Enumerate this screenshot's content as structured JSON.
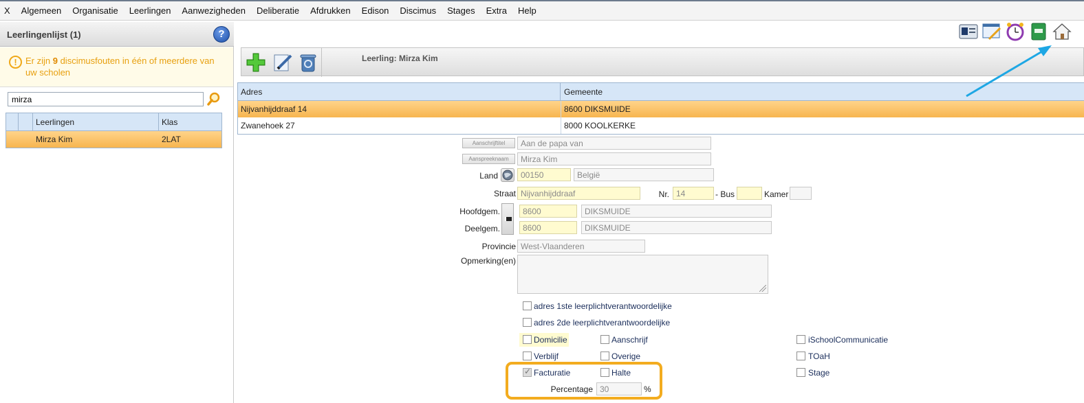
{
  "menu": [
    "X",
    "Algemeen",
    "Organisatie",
    "Leerlingen",
    "Aanwezigheden",
    "Deliberatie",
    "Afdrukken",
    "Edison",
    "Discimus",
    "Stages",
    "Extra",
    "Help"
  ],
  "left_panel": {
    "title": "Leerlingenlijst (1)",
    "help": "?",
    "warning_prefix": "Er zijn ",
    "warning_count": "9",
    "warning_suffix": " discimusfouten in één of meerdere van uw scholen",
    "search_value": "mirza",
    "columns": [
      "Leerlingen",
      "Klas"
    ],
    "rows": [
      {
        "name": "Mirza Kim",
        "klas": "2LAT"
      }
    ]
  },
  "toolbar": {
    "title": "Leerling: Mirza Kim"
  },
  "addresses": {
    "columns": [
      "Adres",
      "Gemeente"
    ],
    "rows": [
      {
        "adres": "Nijvanhijddraaf 14",
        "gemeente": "8600 DIKSMUIDE",
        "selected": true
      },
      {
        "adres": "Zwanehoek 27",
        "gemeente": "8000 KOOLKERKE",
        "selected": false
      }
    ]
  },
  "form": {
    "aanschrijftitel_btn": "Aanschrijftitel",
    "aanschrijftitel": "Aan de papa van",
    "aanspreeknaam_btn": "Aanspreeknaam",
    "aanspreeknaam": "Mirza Kim",
    "land_label": "Land",
    "land_code": "00150",
    "land_name": "België",
    "straat_label": "Straat",
    "straat": "Nijvanhijddraaf",
    "nr_label": "Nr.",
    "nr": "14",
    "bus_label": "- Bus",
    "bus": "",
    "kamer_label": "Kamer",
    "kamer": "",
    "hoofdgem_label": "Hoofdgem.",
    "hoofdgem_code": "8600",
    "hoofdgem_name": "DIKSMUIDE",
    "deelgem_label": "Deelgem.",
    "deelgem_code": "8600",
    "deelgem_name": "DIKSMUIDE",
    "provincie_label": "Provincie",
    "provincie": "West-Vlaanderen",
    "opmerking_label": "Opmerking(en)",
    "opmerking": "",
    "cb_1ste": "adres 1ste leerplichtverantwoordelijke",
    "cb_2de": "adres 2de leerplichtverantwoordelijke",
    "cb_domicilie": "Domicilie",
    "cb_aanschrijf": "Aanschrijf",
    "cb_ischool": "iSchoolCommunicatie",
    "cb_verblijf": "Verblijf",
    "cb_overige": "Overige",
    "cb_toah": "TOaH",
    "cb_facturatie": "Facturatie",
    "cb_halte": "Halte",
    "cb_stage": "Stage",
    "percentage_label": "Percentage",
    "percentage": "30",
    "percent_sign": "%"
  },
  "colors": {
    "accent_orange": "#f3ac1f",
    "selection": "#f7b54f",
    "header_blue": "#d6e6f7",
    "arrow": "#1ea7e4"
  }
}
